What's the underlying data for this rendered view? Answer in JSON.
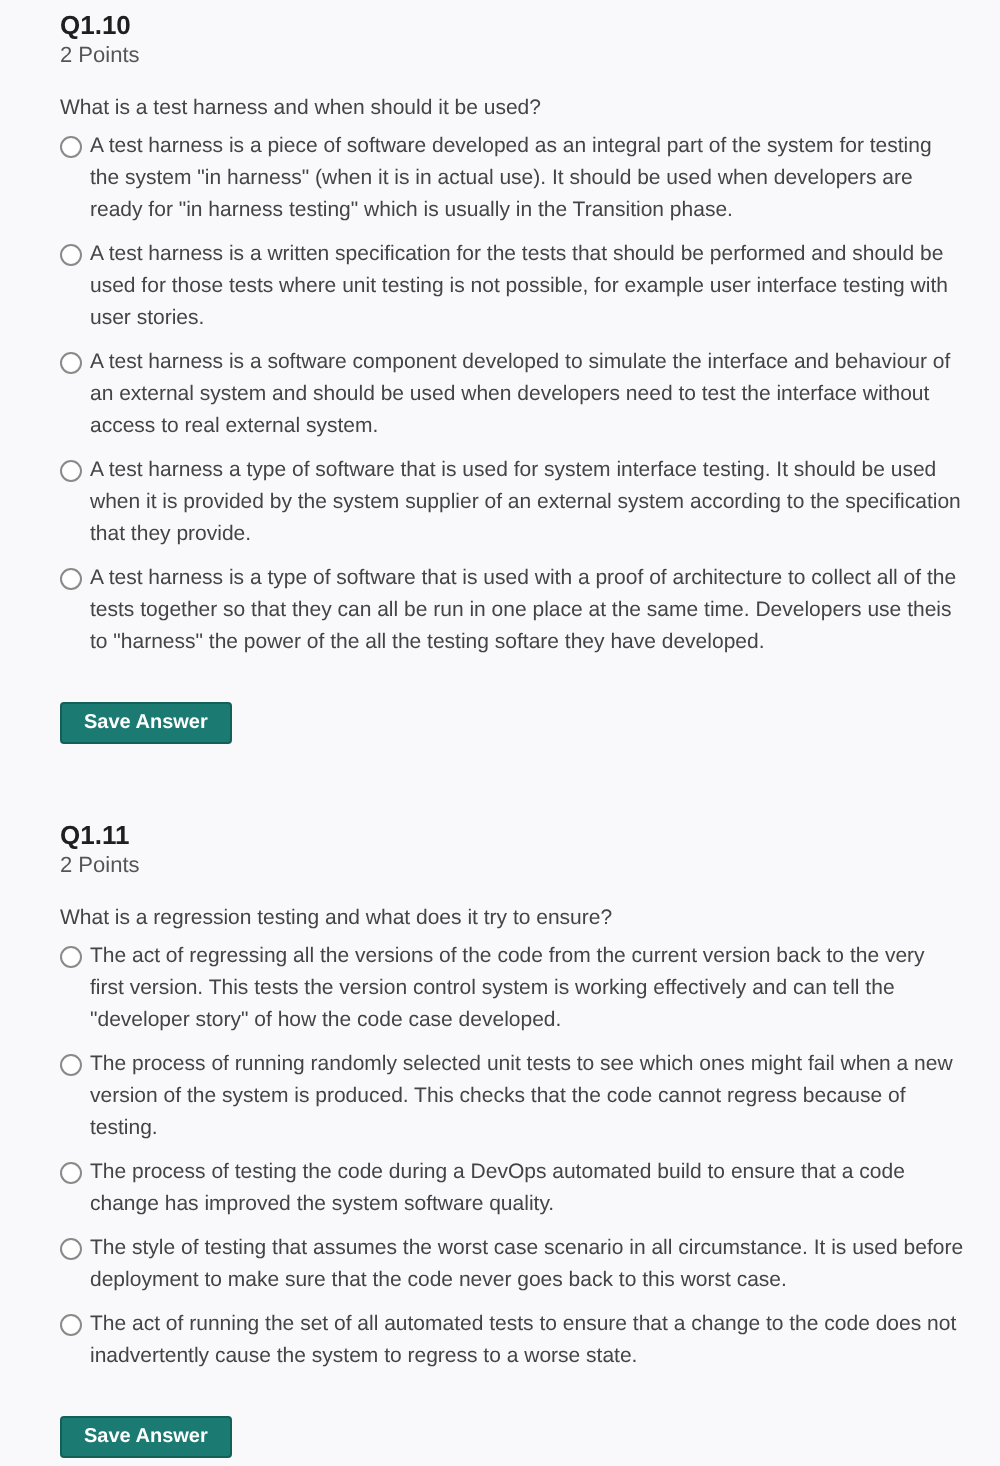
{
  "questions": [
    {
      "number": "Q1.10",
      "points": "2 Points",
      "prompt": "What is a test harness and when should it be used?",
      "options": [
        {
          "text": "A test harness is a piece of software developed as an integral part of the system for testing the system \"in harness\" (when it is in actual use). It should be used when developers are ready for \"in harness testing\" which is usually in the Transition phase.",
          "selected": false
        },
        {
          "text": "A test harness is a written specification for the tests that should be performed and should be used for those tests where unit testing is not possible, for example user interface testing with user stories.",
          "selected": false
        },
        {
          "text": "A test harness is a software component developed to simulate the interface and behaviour of an external system and should be used when developers need to test the interface without access to real external system.",
          "selected": false
        },
        {
          "text": "A test harness a type of software that is used for system interface testing. It should be used when it is provided by the system supplier of an external system according to the specification that they provide.",
          "selected": false
        },
        {
          "text": "A test harness is a type of software that is used with a proof of architecture to collect all of the tests together so that they can all be run in one place at the same time. Developers use theis to \"harness\" the power of the all the testing softare they have developed.",
          "selected": false
        }
      ],
      "button": "Save Answer"
    },
    {
      "number": "Q1.11",
      "points": "2 Points",
      "prompt": "What is a regression testing and what does it try to ensure?",
      "options": [
        {
          "text": "The act of regressing all the versions of the code from the current version back to the very first version. This tests the version control system is working effectively and can tell the \"developer story\" of how the code case developed.",
          "selected": false
        },
        {
          "text": "The process of running randomly selected unit tests to see which ones might fail when a new version of the system is produced. This checks that the code cannot regress because of testing.",
          "selected": false
        },
        {
          "text": "The process of testing the code during a DevOps automated build to ensure that a code change has improved the system software quality.",
          "selected": false
        },
        {
          "text": "The style of testing that assumes the worst case scenario in all circumstance. It is used before deployment to make sure that the code never goes back to this worst case.",
          "selected": false
        },
        {
          "text": "The act of running the set of all automated tests to ensure that a change to the code does not inadvertently cause the system to regress to a worse state.",
          "selected": false
        }
      ],
      "button": "Save Answer"
    }
  ]
}
